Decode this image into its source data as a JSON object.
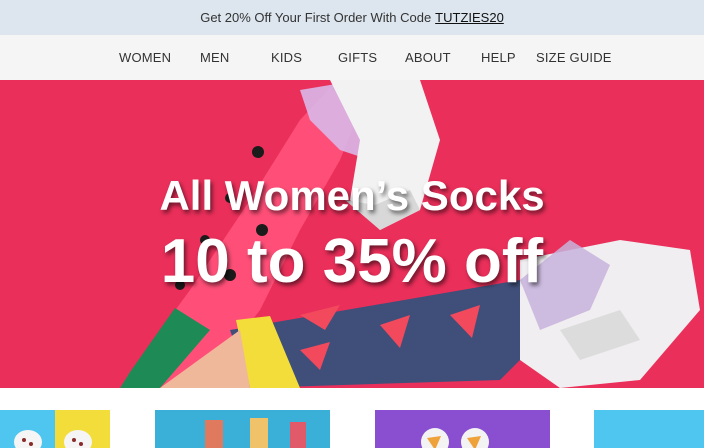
{
  "promo": {
    "text": "Get 20% Off Your First Order With Code",
    "code": "TUTZIES20"
  },
  "nav": {
    "items": [
      "WOMEN",
      "MEN",
      "KIDS",
      "GIFTS",
      "ABOUT",
      "HELP",
      "SIZE GUIDE"
    ]
  },
  "hero": {
    "title": "All Women’s Socks",
    "subtitle": "10 to 35% off"
  },
  "colors": {
    "promo_bg": "#dde6ef",
    "nav_bg": "#f5f5f5",
    "hero_bg": "#ea2f5a"
  }
}
